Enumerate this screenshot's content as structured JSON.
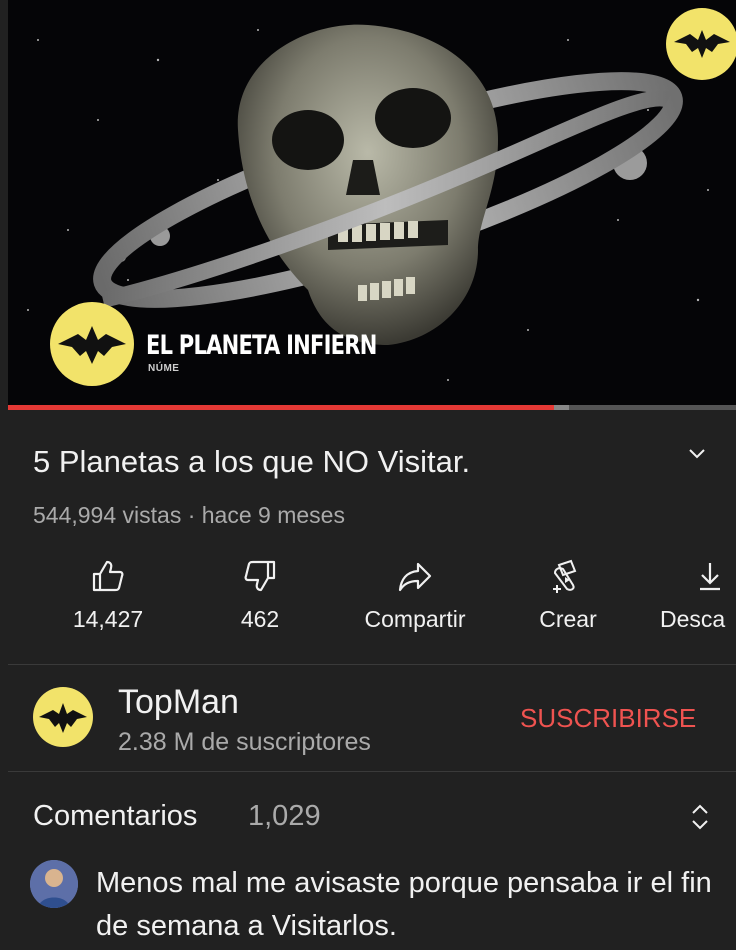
{
  "player": {
    "overlay_title": "EL PLANETA INFIERN",
    "overlay_subtitle": "NÚME",
    "progress_fraction": 0.75,
    "buffer_fraction": 0.77
  },
  "video": {
    "title": "5 Planetas a los que NO Visitar.",
    "meta": "544,994 vistas · hace 9 meses"
  },
  "actions": [
    {
      "icon": "thumbs-up-icon",
      "label": "14,427"
    },
    {
      "icon": "thumbs-down-icon",
      "label": "462"
    },
    {
      "icon": "share-icon",
      "label": "Compartir"
    },
    {
      "icon": "create-icon",
      "label": "Crear"
    },
    {
      "icon": "download-icon",
      "label": "Desca"
    }
  ],
  "channel": {
    "name": "TopMan",
    "subscribers": "2.38 M de suscriptores",
    "subscribe_label": "SUSCRIBIRSE"
  },
  "comments": {
    "title": "Comentarios",
    "count": "1,029",
    "first_comment": "Menos mal me avisaste porque  pensaba ir el fin de semana a Visitarlos."
  },
  "colors": {
    "background": "#212121",
    "progress": "#e53935",
    "subscribe": "#ef5350",
    "logo_yellow": "#f2e36a"
  }
}
